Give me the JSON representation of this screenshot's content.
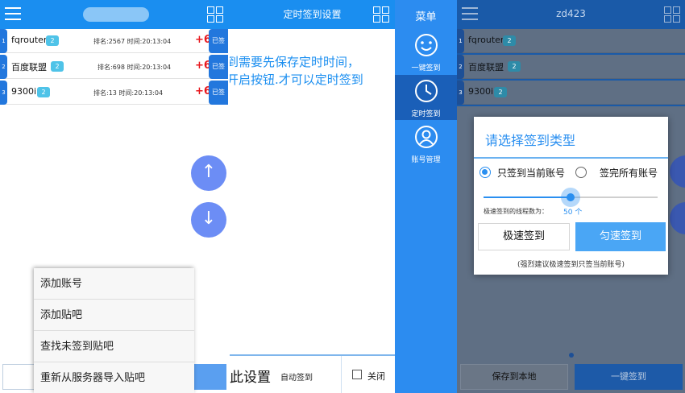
{
  "screen1": {
    "accounts": [
      {
        "index": "1",
        "name": "fqrouter",
        "level": "2",
        "rank_text": "排名:2567 时间:20:13:04",
        "points": "+6",
        "status": "已签"
      },
      {
        "index": "2",
        "name": "百度联盟",
        "level": "2",
        "rank_text": "排名:698 时间:20:13:04",
        "points": "+6",
        "status": "已签"
      },
      {
        "index": "3",
        "name": "9300i",
        "level": "2",
        "rank_text": "排名:13 时间:20:13:04",
        "points": "+6",
        "status": "已签"
      }
    ],
    "fab_up": "↑",
    "fab_down": "↓",
    "context_menu": [
      "添加账号",
      "添加贴吧",
      "查找未签到贴吧",
      "重新从服务器导入贴吧"
    ]
  },
  "screen2": {
    "title": "定时签到设置",
    "info_line1": "到需要先保存定时时间，",
    "info_line2": "开启按钮.才可以定时签到",
    "save_label": "此设置",
    "auto_label": "自动签到",
    "close_label": "关闭"
  },
  "menu": {
    "title": "菜单",
    "items": [
      {
        "label": "一键签到",
        "icon": "smiley-icon"
      },
      {
        "label": "定时签到",
        "icon": "clock-icon"
      },
      {
        "label": "账号管理",
        "icon": "user-icon"
      }
    ],
    "accent": "#2c8cf0"
  },
  "screen4": {
    "title": "zd423",
    "accounts": [
      {
        "index": "1",
        "name": "fqrouter",
        "level": "2"
      },
      {
        "index": "2",
        "name": "百度联盟",
        "level": "2"
      },
      {
        "index": "3",
        "name": "9300i",
        "level": "2"
      }
    ],
    "bottom_left": "保存到本地",
    "bottom_right": "一键签到",
    "dialog": {
      "title": "请选择签到类型",
      "option1": "只签到当前账号",
      "option2": "签完所有账号",
      "selected": "option1",
      "thread_label": "极速签到的线程数为：",
      "thread_value": "50 个",
      "slider_level": 0.5,
      "btn_fast": "极速签到",
      "btn_even": "匀速签到",
      "note": "(强烈建议极速签到只签当前账号)"
    }
  }
}
